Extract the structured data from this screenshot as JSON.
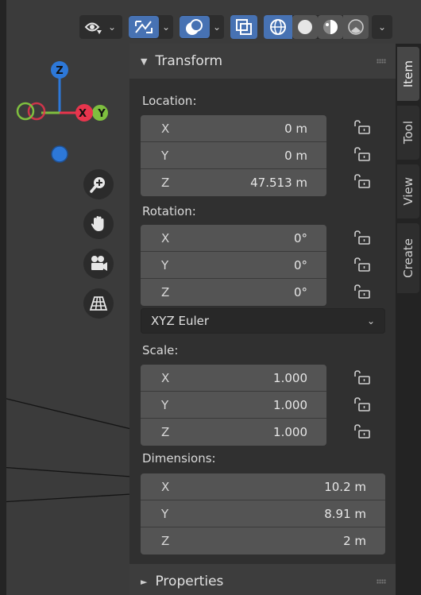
{
  "header": {
    "icons": [
      "view-object-types-icon",
      "gizmo-toggle-icon",
      "overlays-icon",
      "xray-toggle-icon",
      "wireframe-shading-icon",
      "solid-shading-icon",
      "material-preview-icon",
      "rendered-shading-icon"
    ],
    "accent": "#4772b3"
  },
  "gizmo": {
    "z_label": "Z",
    "x_label": "X",
    "y_label": "Y",
    "colors": {
      "x": "#e8354d",
      "y": "#7fbf3f",
      "z": "#2d78d8"
    }
  },
  "panel": {
    "title": "Transform",
    "location_label": "Location:",
    "location": [
      {
        "axis": "X",
        "value": "0 m"
      },
      {
        "axis": "Y",
        "value": "0 m"
      },
      {
        "axis": "Z",
        "value": "47.513 m"
      }
    ],
    "rotation_label": "Rotation:",
    "rotation": [
      {
        "axis": "X",
        "value": "0°"
      },
      {
        "axis": "Y",
        "value": "0°"
      },
      {
        "axis": "Z",
        "value": "0°"
      }
    ],
    "rotation_mode": "XYZ Euler",
    "scale_label": "Scale:",
    "scale": [
      {
        "axis": "X",
        "value": "1.000"
      },
      {
        "axis": "Y",
        "value": "1.000"
      },
      {
        "axis": "Z",
        "value": "1.000"
      }
    ],
    "dimensions_label": "Dimensions:",
    "dimensions": [
      {
        "axis": "X",
        "value": "10.2 m"
      },
      {
        "axis": "Y",
        "value": "8.91 m"
      },
      {
        "axis": "Z",
        "value": "2 m"
      }
    ],
    "properties_title": "Properties"
  },
  "tabs": [
    "Item",
    "Tool",
    "View",
    "Create"
  ]
}
